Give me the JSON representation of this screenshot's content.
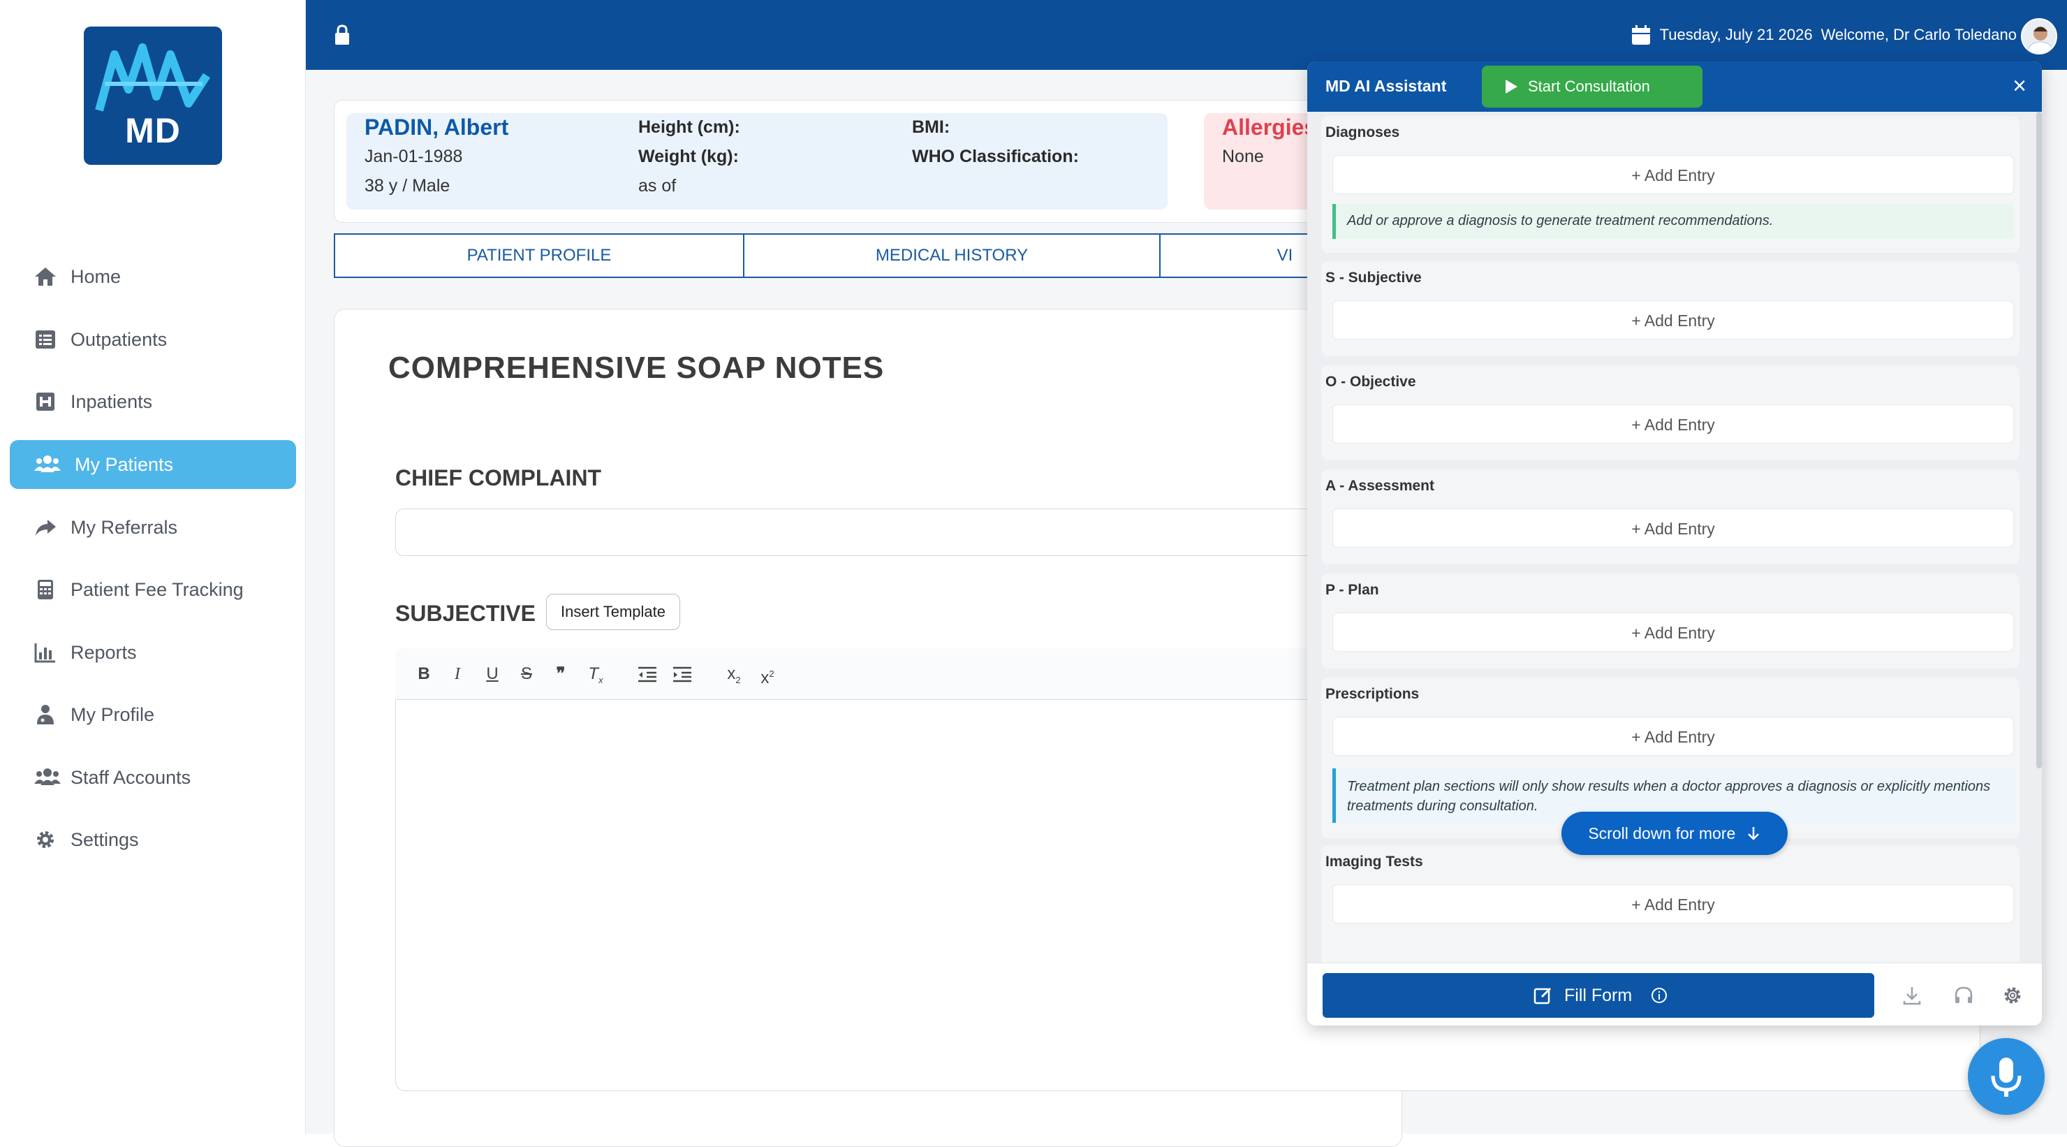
{
  "app": {
    "logo_text": "MD"
  },
  "sidebar": {
    "items": [
      {
        "label": "Home",
        "icon": "home-icon"
      },
      {
        "label": "Outpatients",
        "icon": "list-icon"
      },
      {
        "label": "Inpatients",
        "icon": "hospital-icon"
      },
      {
        "label": "My Patients",
        "icon": "users-icon",
        "active": true
      },
      {
        "label": "My Referrals",
        "icon": "share-icon"
      },
      {
        "label": "Patient Fee Tracking",
        "icon": "calculator-icon"
      },
      {
        "label": "Reports",
        "icon": "bar-chart-icon"
      },
      {
        "label": "My Profile",
        "icon": "doctor-icon"
      },
      {
        "label": "Staff Accounts",
        "icon": "users-icon"
      },
      {
        "label": "Settings",
        "icon": "gear-icon"
      }
    ]
  },
  "header": {
    "date": "Tuesday, July 21 2026",
    "welcome": "Welcome, Dr Carlo Toledano"
  },
  "patient": {
    "name": "PADIN, Albert",
    "dob": "Jan-01-1988",
    "age_sex": "38 y / Male",
    "height_label": "Height (cm):",
    "weight_label": "Weight (kg):",
    "as_of": "as of",
    "bmi_label": "BMI:",
    "who_label": "WHO Classification:",
    "allergies_label": "Allergies",
    "allergies_value": "None"
  },
  "tabs": [
    "PATIENT PROFILE",
    "MEDICAL HISTORY",
    "VI"
  ],
  "soap": {
    "title": "COMPREHENSIVE SOAP NOTES",
    "chief_complaint_label": "CHIEF COMPLAINT",
    "subjective_label": "SUBJECTIVE",
    "insert_template": "Insert Template"
  },
  "ai": {
    "title": "MD AI Assistant",
    "start_label": "Start Consultation",
    "add_entry": "+ Add Entry",
    "sections": [
      "Diagnoses",
      "S - Subjective",
      "O - Objective",
      "A - Assessment",
      "P - Plan",
      "Prescriptions",
      "Imaging Tests"
    ],
    "diagnosis_note": "Add or approve a diagnosis to generate treatment recommendations.",
    "treatment_note": "Treatment plan sections will only show results when a doctor approves a diagnosis or explicitly mentions treatments during consultation.",
    "scroll_more": "Scroll down for more",
    "fill_form": "Fill Form"
  },
  "colors": {
    "primary": "#0d4e99",
    "active_nav": "#4fb6ea",
    "start_green": "#36a94a",
    "allergy_red": "#e04050"
  }
}
